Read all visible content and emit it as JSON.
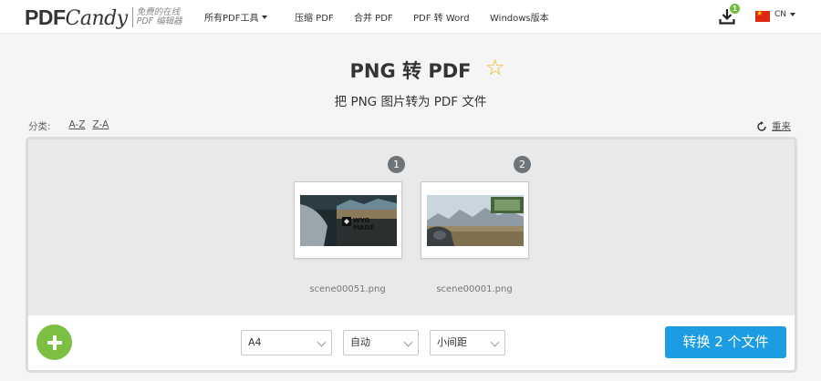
{
  "header": {
    "logo": {
      "word1": "PDF",
      "word2": "Candy",
      "tagline_line1": "免费的在线",
      "tagline_line2": "PDF 编辑器"
    },
    "nav": [
      {
        "label": "所有PDF工具",
        "has_dropdown": true
      },
      {
        "label": "压缩 PDF"
      },
      {
        "label": "合并 PDF"
      },
      {
        "label": "PDF 转 Word"
      },
      {
        "label": "Windows版本"
      }
    ],
    "download_icon": "download-icon",
    "download_count": "1",
    "language": "CN",
    "flag": "china-flag"
  },
  "page": {
    "title": "PNG 转 PDF",
    "favorite_icon": "star-outline-icon",
    "subtitle": "把 PNG 图片转为 PDF 文件"
  },
  "sort": {
    "label": "分类:",
    "options": [
      "A-Z",
      "Z-A"
    ]
  },
  "reset": {
    "label": "重来",
    "icon": "reset-icon"
  },
  "files": [
    {
      "index": "1",
      "name": "scene00051.png"
    },
    {
      "index": "2",
      "name": "scene00001.png"
    }
  ],
  "toolbar": {
    "add_icon": "plus-icon",
    "page_size": "A4",
    "orientation": "自动",
    "margin": "小间距",
    "convert_label": "转换 2 个文件"
  },
  "colors": {
    "accent": "#1c9ce3",
    "add": "#7bc043",
    "star": "#f2b51e",
    "badge": "#6e7478"
  }
}
